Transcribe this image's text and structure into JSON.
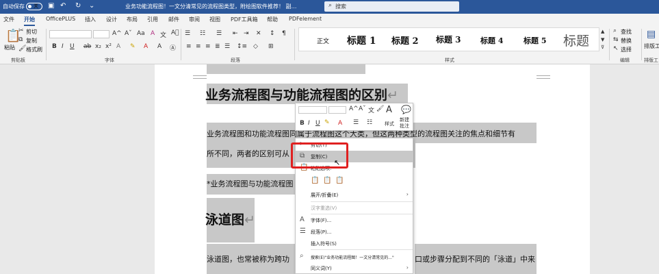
{
  "titlebar": {
    "autosave_label": "自动保存",
    "autosave_state": "关",
    "doc_title": "业务功能流程图！一文分清常见的流程图类型，附绘图软件推荐！  副…",
    "search_placeholder": "搜索"
  },
  "tabs": [
    "文件",
    "开始",
    "OfficePLUS",
    "插入",
    "设计",
    "布局",
    "引用",
    "邮件",
    "审阅",
    "视图",
    "PDF工具箱",
    "帮助",
    "PDFelement"
  ],
  "active_tab": "开始",
  "ribbon": {
    "paste": "粘贴",
    "cut": "剪切",
    "copy": "复制",
    "format_painter": "格式刷",
    "clipboard_group": "剪贴板",
    "font_group": "字体",
    "paragraph_group": "段落",
    "styles_group": "样式",
    "editing_group": "编辑",
    "layout_group": "排版工",
    "find": "查找",
    "replace": "替换",
    "select": "选择",
    "layout_tool": "排版工",
    "styles": [
      "正文",
      "标题 1",
      "标题 2",
      "标题 3",
      "标题 4",
      "标题 5",
      "标题"
    ]
  },
  "document": {
    "heading1": "业务流程图与功能流程图的区别",
    "para1a": "业务流程图和功能流程图同属于流程图这个大类，但这两种类型的流程图关注的焦点和细节有",
    "para1b": "所不同，两者的区别可从",
    "para2": "*业务流程图与功能流程图",
    "heading2": "泳道图",
    "para3a": "泳道图，也常被称为跨功",
    "para3b": "口或步骤分配到不同的「泳道」中来"
  },
  "mini_toolbar": {
    "styles_label": "样式",
    "new_comment_label_1": "新建",
    "new_comment_label_2": "批注"
  },
  "context_menu": {
    "cut": "剪切(T)",
    "copy": "复制(C)",
    "paste_options": "粘贴选项:",
    "expand_collapse": "展开/折叠(E)",
    "reconvert": "汉字重选(V)",
    "font": "字体(F)...",
    "paragraph": "段落(P)...",
    "insert_symbol": "插入符号(S)",
    "search": "搜索(E)\"业务功能流程图！一文分清常见的...\"",
    "synonyms": "同义词(Y)"
  },
  "colors": {
    "brand": "#2b579a",
    "highlight_box": "#e02020",
    "selection": "#c8c8c8"
  }
}
